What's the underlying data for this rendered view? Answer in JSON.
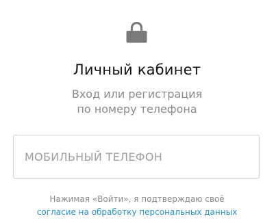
{
  "header": {
    "icon": "lock-icon",
    "title": "Личный кабинет",
    "subtitle_line1": "Вход или регистрация",
    "subtitle_line2": "по номеру телефона"
  },
  "form": {
    "phone_placeholder": "МОБИЛЬНЫЙ ТЕЛЕФОН",
    "phone_value": ""
  },
  "consent": {
    "text": "Нажимая «Войти», я подтверждаю своё",
    "link_label": "согласие на обработку персональных данных"
  },
  "colors": {
    "icon": "#7a7a7a",
    "title": "#111111",
    "muted_text": "#8a8a8a",
    "link": "#2a93c6",
    "input_border": "#cfcfcf"
  }
}
